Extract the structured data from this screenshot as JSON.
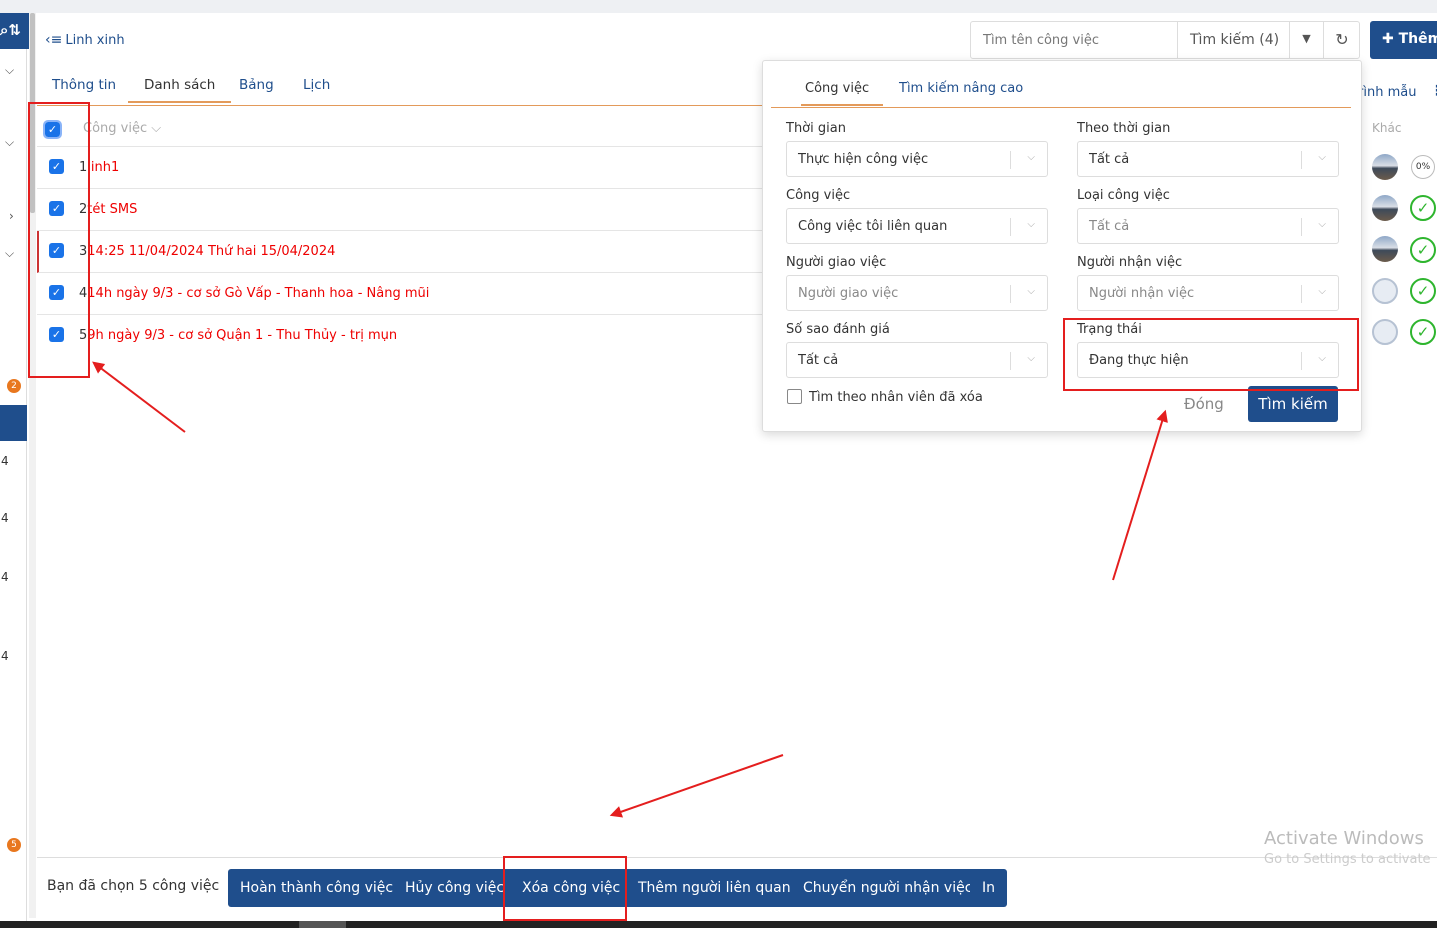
{
  "nav": {
    "back_label": "Linh xinh",
    "tabs": [
      "Thông tin",
      "Danh sách",
      "Bảng",
      "Lịch"
    ],
    "left_numbers": [
      "4",
      "4",
      "4",
      "4"
    ],
    "badges": [
      "2",
      "5"
    ]
  },
  "list": {
    "column_header": "Công việc",
    "rows": [
      {
        "index": "1",
        "title": "linh1"
      },
      {
        "index": "2",
        "title": "tét SMS"
      },
      {
        "index": "3",
        "title": "14:25 11/04/2024 Thứ hai 15/04/2024"
      },
      {
        "index": "4",
        "title": "14h ngày 9/3 - cơ sở Gò Vấp - Thanh hoa - Nâng mũi"
      },
      {
        "index": "5",
        "title": "9h ngày 9/3 - cơ sở Quận 1 - Thu Thủy - trị mụn"
      }
    ]
  },
  "search": {
    "placeholder": "Tìm tên công việc",
    "button": "Tìm kiếm (4)",
    "add_button": "Thêm"
  },
  "right": {
    "template_link": "rình mẫu",
    "other_header": "Khác",
    "progress": "0%"
  },
  "popup": {
    "tabs": [
      "Công việc",
      "Tìm kiếm nâng cao"
    ],
    "fields": {
      "thoi_gian": {
        "label": "Thời gian",
        "value": "Thực hiện công việc"
      },
      "theo_thoi_gian": {
        "label": "Theo thời gian",
        "value": "Tất cả"
      },
      "cong_viec": {
        "label": "Công việc",
        "value": "Công việc tôi liên quan"
      },
      "loai_cong_viec": {
        "label": "Loại công việc",
        "value": "Tất cả"
      },
      "nguoi_giao_viec": {
        "label": "Người giao việc",
        "placeholder": "Người giao việc"
      },
      "nguoi_nhan_viec": {
        "label": "Người nhận việc",
        "placeholder": "Người nhận việc"
      },
      "so_sao": {
        "label": "Số sao đánh giá",
        "value": "Tất cả"
      },
      "trang_thai": {
        "label": "Trạng thái",
        "value": "Đang thực hiện"
      }
    },
    "deleted_staff_checkbox": "Tìm theo nhân viên đã xóa",
    "close": "Đóng",
    "search_button": "Tìm kiếm"
  },
  "bottom": {
    "selected_text": "Bạn đã chọn 5 công việc",
    "buttons": [
      "Hoàn thành công việc",
      "Hủy công việc",
      "Xóa công việc",
      "Thêm người liên quan",
      "Chuyển người nhận việc",
      "In"
    ]
  },
  "watermark": {
    "line1": "Activate Windows",
    "line2": "Go to Settings to activate"
  },
  "colors": {
    "primary": "#1f4e8c",
    "accent": "#e39a5a",
    "annotation": "#e41e1e",
    "task_text": "#e00000"
  }
}
